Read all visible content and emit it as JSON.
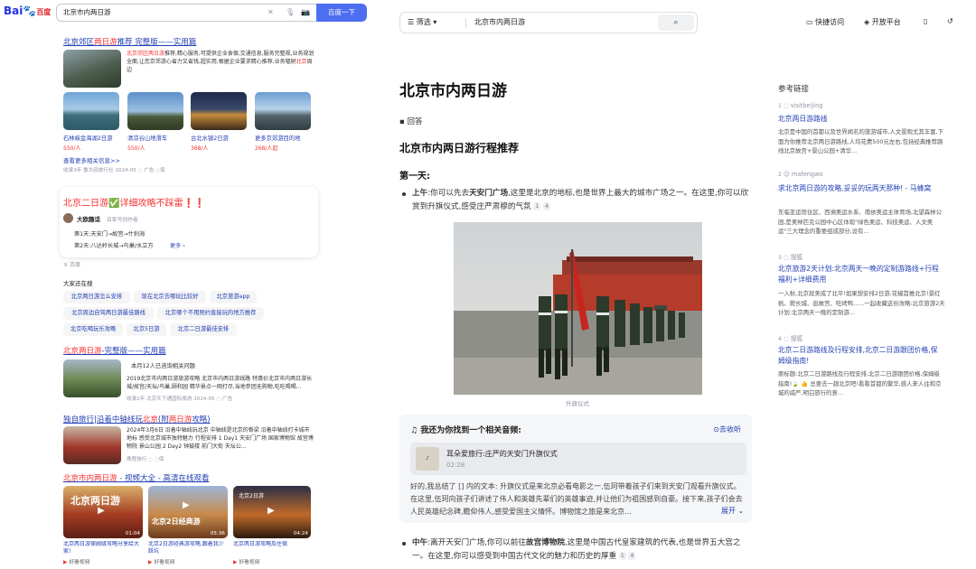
{
  "left": {
    "logo_text": "Bai",
    "logo_paw": "du",
    "logo_cn": "百度",
    "query": "北京市内两日游",
    "search_btn": "百度一下",
    "r1": {
      "title_a": "北京郊区",
      "title_b": "两日游",
      "title_c": "推荐 完整版——实用篇",
      "body_a": "北京郊区两日游",
      "body_b": "推荐,精心服务,可提供企业食宿,交通信息,服务完整规,业务规划全面,让您京郊游心省力又省钱,超实用,根据企业要求精心推荐,业务辐射",
      "body_c": "北京",
      "body_d": "周边",
      "spots": [
        {
          "name": "石林峡金海湖2日游",
          "price": "550/人"
        },
        {
          "name": "清凉谷山地滑车",
          "price": "550/人"
        },
        {
          "name": "古北水镇2日游",
          "price": "368/人"
        },
        {
          "name": "更多京郊游目的地",
          "price": "268/人起"
        }
      ],
      "more": "查看更多相关信息>>",
      "meta": "收录3年  鲁大叔旅行社  2024-05  ◌  广告  ◌保"
    },
    "r2": {
      "title": "北京二日游✅详细攻略不踩雷❗❗",
      "author": "大欧趣话",
      "author_tag": "百家号创作者",
      "day1": "第1天:天安门→故宫→什刹海",
      "day2": "第2天:八达岭长城→鸟巢/水立方",
      "more": "更多 ›",
      "source": "百度"
    },
    "also_title": "大家还在搜",
    "chips": [
      "北京两日游怎么安排",
      "现在北京去哪玩比较好",
      "北京旅游app",
      "北京周边自驾两日游最佳路线",
      "北京哪个不用预约直接玩的地方推荐",
      "北京吃喝玩乐攻略",
      "北京5日游",
      "北京二日游最佳安排"
    ],
    "r3": {
      "title_a": "北京两日游",
      "title_b": "-完整版——实用篇",
      "q": "本月12人已咨询相关问题",
      "body": "2019北京市内两日游旅游攻略 北京市内两日游线路 特惠价北京市内两日游长城/故宫/天坛/鸟巢,颐和园 精华景点一网打尽,当地参团无购物,吃吃喝喝...",
      "meta": "收录2年  北京天下通国际旅游  2024-05  ◌  广告"
    },
    "r4": {
      "title_a": "独自旅行|沿着中轴线玩",
      "title_b": "北京",
      "title_c": "(附",
      "title_d": "两日游",
      "title_e": "攻略)",
      "body": "2024年3月6日 沿着中轴线玩北京 中轴线是北京的脊梁 沿着中轴线打卡城市地标 感受北京城市独特魅力 行程安排 1 Day1 天安门广场 国家博物馆 故宫博物院 景山公园 2 Day2 钟鼓楼 前门大街 天坛公...",
      "meta": "携程旅行  ◌  ◌保"
    },
    "r5": {
      "title_a": "北京市内两日游",
      "title_b": " - 视频大全 - 高清在线观看",
      "videos": [
        {
          "overlay": "北京两日游",
          "dur": "01:04",
          "cap": "北京两日游保姆级攻略分享给大家!",
          "src": "好看视频"
        },
        {
          "overlay": "北京2日经典游",
          "dur": "05:36",
          "cap": "北京2日游经典游攻略,跟着我少踩坑",
          "src": "好看视频"
        },
        {
          "overlay": "北京2日游",
          "dur": "04:24",
          "cap": "北京两日游攻略及住宿",
          "src": "好看视频"
        }
      ]
    }
  },
  "right": {
    "filter": "筛选",
    "query": "北京市内两日游",
    "top_actions": [
      "快捷访问",
      "开放平台"
    ],
    "title": "北京市内两日游",
    "answer_label": "回答",
    "h2": "北京市内两日游行程推荐",
    "day1": "第一天:",
    "morning_label": "上午",
    "morning_a": ":你可以先去",
    "morning_b": "天安门广场",
    "morning_c": ",这里是北京的地标,也是世界上最大的城市广场之一。在这里,你可以欣赏到升旗仪式,感受庄严肃穆的气氛",
    "cite1": "1",
    "cite2": "4",
    "photo_caption": "升旗仪式",
    "music_title": "我还为你找到一个相关音频:",
    "music_collapse": "去收听",
    "audio_name": "耳朵爱旅行:庄严的天安门升旗仪式",
    "audio_time": "02:28",
    "music_body": "好的,我总结了 [] 内的文本: 升旗仪式是来北京必看电影之一,伍珂带着孩子们来到天安门观看升旗仪式。在这里,伍珂向孩子们讲述了伟人和英雄先辈们的英雄事迹,并让他们为祖国感到自豪。接下来,孩子们会去人民英雄纪念碑,瞻仰伟人,感受爱国主义情怀。博物馆之旅是来北京...",
    "music_more": "展开 ⌄",
    "noon_label": "中午",
    "noon_a": ":离开天安门广场,你可以前往",
    "noon_b": "故宫博物院",
    "noon_c": ",这里是中国古代皇家建筑的代表,也是世界五大宫之一。在这里,你可以感受到中国古代文化的魅力和历史的厚重",
    "refs_title": "参考链接",
    "refs": [
      {
        "num": "1",
        "src": "visitbeijing",
        "title": "北京两日游路线",
        "body": "北京是中国的首都以及世界闻名的旅游城市,人文景观尤其丰富,下面为你推荐北京两日游路线,人均花费500元左右,包括经典推荐路线北京故宫+景山公园+清华..."
      },
      {
        "num": "2",
        "src": "mafengwo",
        "title": "求北京两日游的攻略,妥妥的玩两天那种! - 马蜂窝",
        "body": "东临亚运馆住区、西濒奥运水系、南依奥运主体育场,北望森林公园,是奥林匹克公园中心区体现\"绿色奥运、科技奥运、人文奥运\"三大理念的重要组成部分,设有..."
      },
      {
        "num": "3",
        "src": "搜狐",
        "title": "北京旅游2天计划:北京两天一晚的定制游路线+行程福利+详细费用",
        "body": "一入秋,北京就美成了北平!如果想安排2日游,花椒首推北京!景红帆、爬长城、逛故宫、吃烤鸭......一起收藏这份攻略:北京旅游2天计划:北京两天一晚的定制游..."
      },
      {
        "num": "4",
        "src": "搜狐",
        "title": "北京二日游路线及行程安排,北京二日游跟团价格,保姆级指南!",
        "body": "原标题:北京二日游路线及行程安排,北京二日游跟团价格,保姆级指南!🍃 👍 总要去一趟北京吧!看看首都的繁华,感人来人往和京城的威严,明白旅行的意..."
      }
    ]
  }
}
